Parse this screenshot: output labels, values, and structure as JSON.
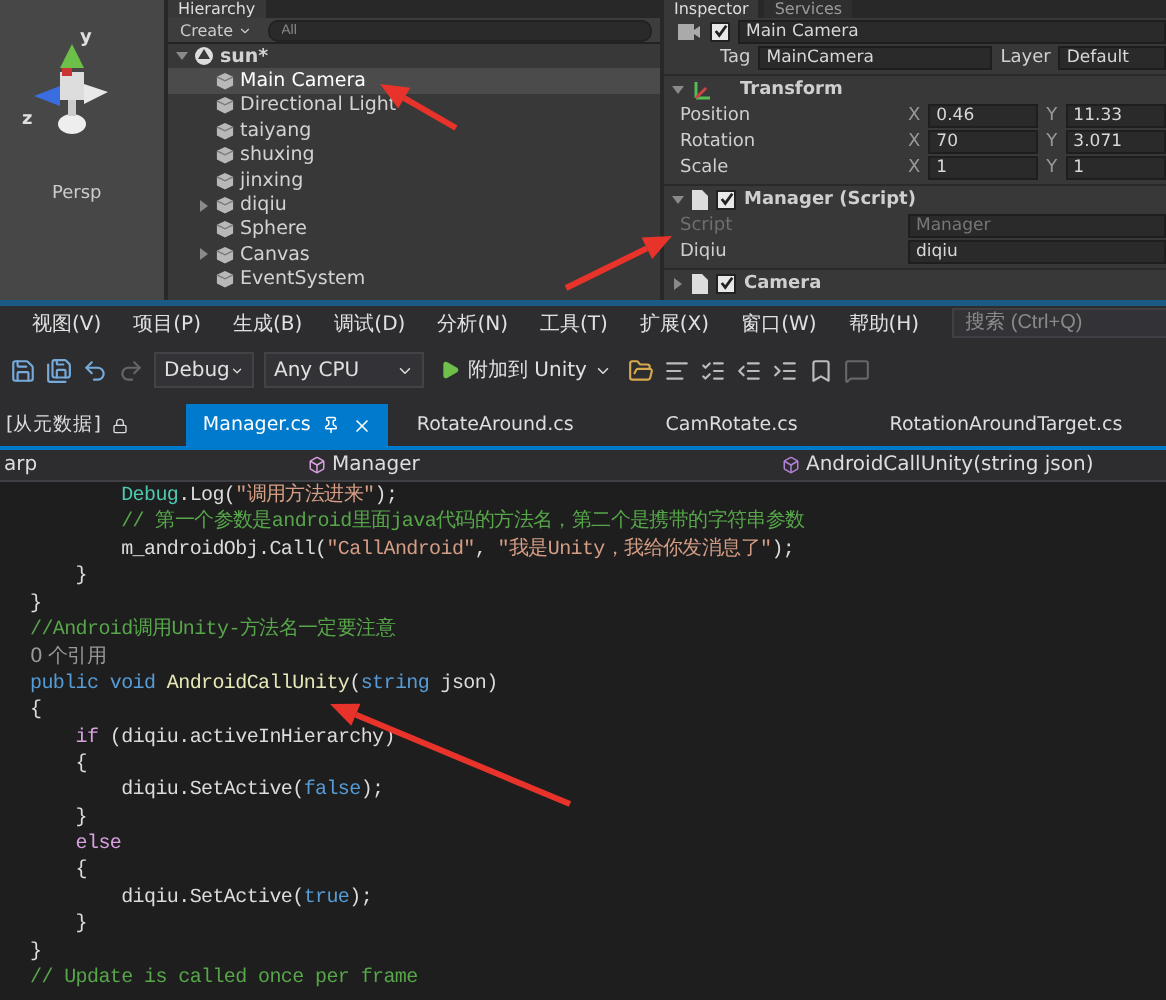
{
  "unity": {
    "scene": {
      "axis_labels": [
        "y",
        "z"
      ],
      "projection": "Persp"
    },
    "hierarchy": {
      "tab": "Hierarchy",
      "create": "Create",
      "search_placeholder": "All",
      "root": "sun*",
      "items": [
        {
          "label": "Main Camera",
          "selected": true,
          "expandable": false
        },
        {
          "label": "Directional Light",
          "selected": false,
          "expandable": false
        },
        {
          "label": "taiyang",
          "selected": false,
          "expandable": false
        },
        {
          "label": "shuxing",
          "selected": false,
          "expandable": false
        },
        {
          "label": "jinxing",
          "selected": false,
          "expandable": false
        },
        {
          "label": "diqiu",
          "selected": false,
          "expandable": true
        },
        {
          "label": "Sphere",
          "selected": false,
          "expandable": false
        },
        {
          "label": "Canvas",
          "selected": false,
          "expandable": true
        },
        {
          "label": "EventSystem",
          "selected": false,
          "expandable": false
        }
      ]
    },
    "inspector": {
      "tabs": [
        {
          "label": "Inspector",
          "selected": true
        },
        {
          "label": "Services",
          "selected": false
        }
      ],
      "object": {
        "name": "Main Camera",
        "active": true,
        "tag_label": "Tag",
        "tag": "MainCamera",
        "layer_label": "Layer",
        "layer": "Default"
      },
      "transform": {
        "title": "Transform",
        "expanded": true,
        "rows": [
          {
            "label": "Position",
            "fields": [
              {
                "axis": "X",
                "value": "0.46"
              },
              {
                "axis": "Y",
                "value": "11.33"
              }
            ]
          },
          {
            "label": "Rotation",
            "fields": [
              {
                "axis": "X",
                "value": "70"
              },
              {
                "axis": "Y",
                "value": "3.071"
              }
            ]
          },
          {
            "label": "Scale",
            "fields": [
              {
                "axis": "X",
                "value": "1"
              },
              {
                "axis": "Y",
                "value": "1"
              }
            ]
          }
        ]
      },
      "components": [
        {
          "title": "Manager (Script)",
          "enabled": true,
          "expanded": true,
          "properties": [
            {
              "label": "Script",
              "value": "Manager",
              "disabled": true
            },
            {
              "label": "Diqiu",
              "value": "diqiu",
              "disabled": false
            }
          ]
        },
        {
          "title": "Camera",
          "enabled": true,
          "expanded": false
        }
      ]
    }
  },
  "vs": {
    "menu": [
      "视图(V)",
      "项目(P)",
      "生成(B)",
      "调试(D)",
      "分析(N)",
      "工具(T)",
      "扩展(X)",
      "窗口(W)",
      "帮助(H)"
    ],
    "search": {
      "placeholder": "搜索 (Ctrl+Q)"
    },
    "toolbar": {
      "configuration": "Debug",
      "platform": "Any CPU",
      "run": "附加到 Unity"
    },
    "tabs": [
      {
        "label": "[从元数据]",
        "selected": false,
        "kind": "locked"
      },
      {
        "label": "Manager.cs",
        "selected": true,
        "kind": "file"
      },
      {
        "label": "RotateAround.cs",
        "selected": false,
        "kind": "file"
      },
      {
        "label": "CamRotate.cs",
        "selected": false,
        "kind": "file"
      },
      {
        "label": "RotationAroundTarget.cs",
        "selected": false,
        "kind": "file"
      }
    ],
    "navigation": [
      "arp",
      "Manager",
      "AndroidCallUnity(string json)"
    ],
    "code": [
      [
        {
          "kind": "type",
          "text": "        Debug"
        },
        {
          "kind": "plain",
          "text": ".Log("
        },
        {
          "kind": "string",
          "text": "\"调用方法进来\""
        },
        {
          "kind": "plain",
          "text": ");"
        }
      ],
      [
        {
          "kind": "comment",
          "text": "        // 第一个参数是android里面java代码的方法名，第二个是携带的字符串参数"
        }
      ],
      [
        {
          "kind": "plain",
          "text": "        m_androidObj.Call("
        },
        {
          "kind": "string",
          "text": "\"CallAndroid\""
        },
        {
          "kind": "plain",
          "text": ", "
        },
        {
          "kind": "string",
          "text": "\"我是Unity，我给你发消息了\""
        },
        {
          "kind": "plain",
          "text": ");"
        }
      ],
      [
        {
          "kind": "plain",
          "text": "    }"
        }
      ],
      [
        {
          "kind": "plain",
          "text": "}"
        }
      ],
      [
        {
          "kind": "comment",
          "text": "//Android调用Unity-方法名一定要注意"
        }
      ],
      [
        {
          "kind": "codelens",
          "text": "0 个引用"
        }
      ],
      [
        {
          "kind": "keyword",
          "text": "public void "
        },
        {
          "kind": "method",
          "text": "AndroidCallUnity"
        },
        {
          "kind": "plain",
          "text": "("
        },
        {
          "kind": "keyword",
          "text": "string"
        },
        {
          "kind": "plain",
          "text": " json)"
        }
      ],
      [
        {
          "kind": "plain",
          "text": "{"
        }
      ],
      [
        {
          "kind": "control",
          "text": "    if"
        },
        {
          "kind": "plain",
          "text": " (diqiu.activeInHierarchy)"
        }
      ],
      [
        {
          "kind": "plain",
          "text": "    {"
        }
      ],
      [
        {
          "kind": "plain",
          "text": "        diqiu.SetActive("
        },
        {
          "kind": "keyword",
          "text": "false"
        },
        {
          "kind": "plain",
          "text": ");"
        }
      ],
      [
        {
          "kind": "plain",
          "text": "    }"
        }
      ],
      [
        {
          "kind": "control",
          "text": "    else"
        }
      ],
      [
        {
          "kind": "plain",
          "text": "    {"
        }
      ],
      [
        {
          "kind": "plain",
          "text": "        diqiu.SetActive("
        },
        {
          "kind": "keyword",
          "text": "true"
        },
        {
          "kind": "plain",
          "text": ");"
        }
      ],
      [
        {
          "kind": "plain",
          "text": "    }"
        }
      ],
      [
        {
          "kind": "plain",
          "text": "}"
        }
      ],
      [
        {
          "kind": "comment",
          "text": "// Update is called once per frame"
        }
      ]
    ]
  }
}
